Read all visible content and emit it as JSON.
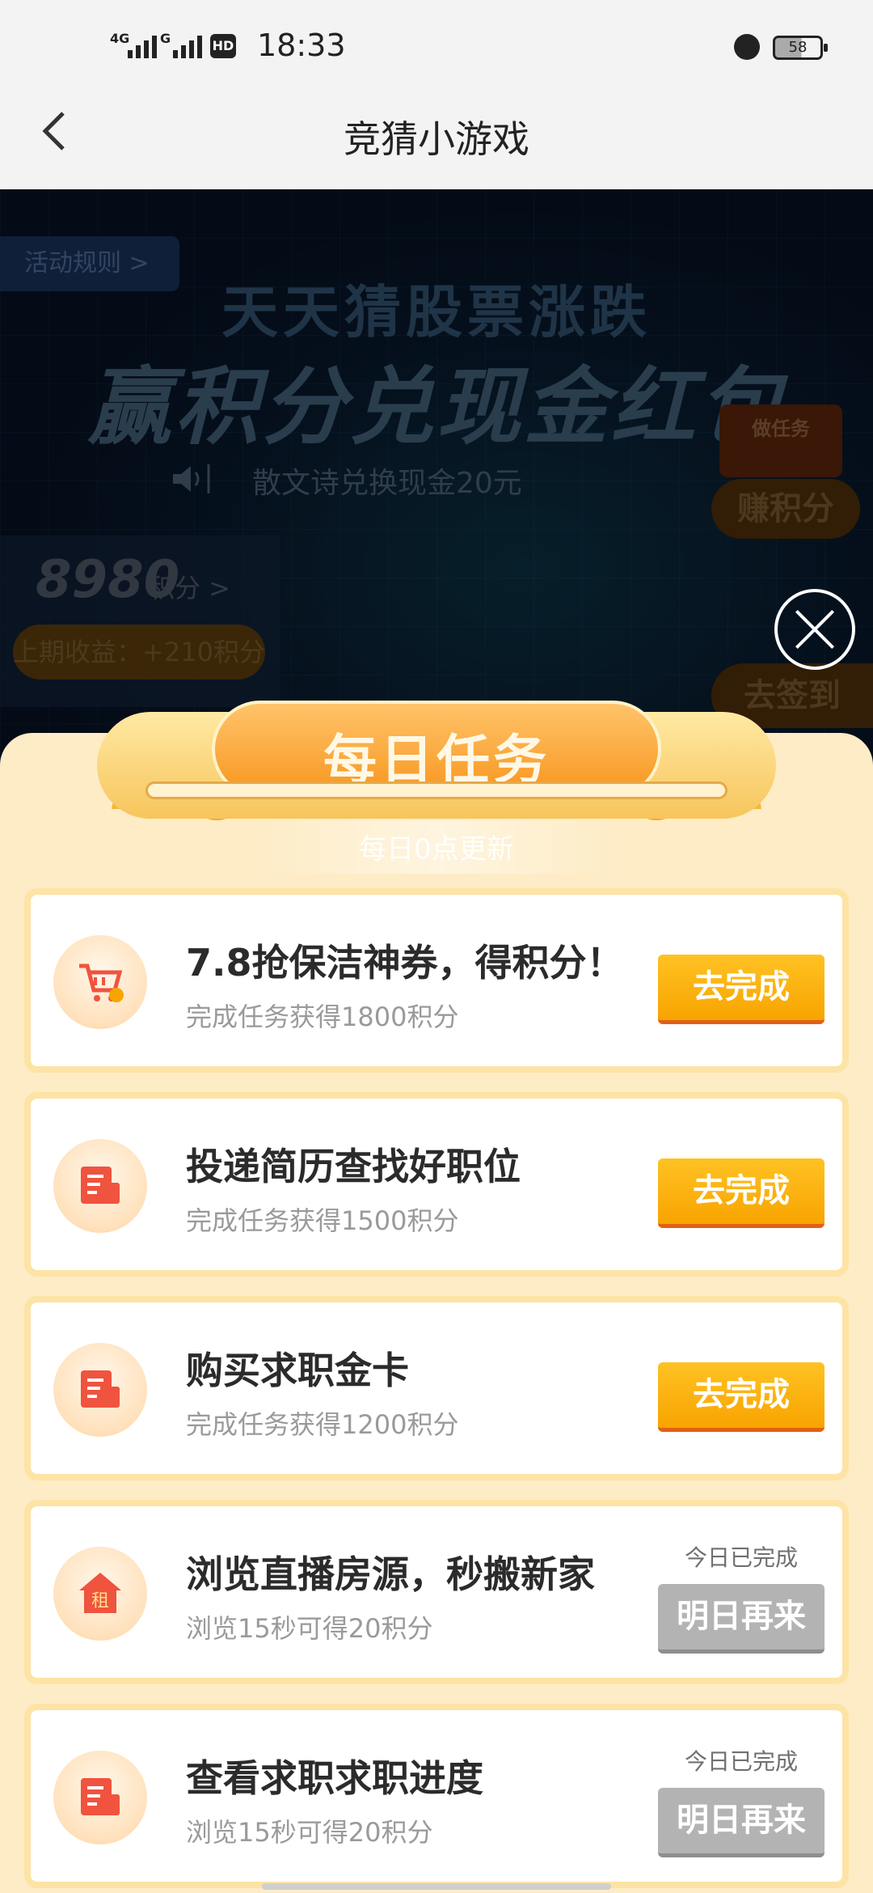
{
  "status_bar": {
    "time": "18:33",
    "network1": "4G",
    "network2": "G",
    "hd_label": "HD",
    "battery": "58"
  },
  "nav": {
    "title": "竞猜小游戏"
  },
  "banner": {
    "rules_label": "活动规则 >",
    "headline1": "天天猜股票涨跌",
    "headline2": "赢积分兑现金红包",
    "announcement": "散文诗兑换现金20元",
    "points_value": "8980",
    "points_label": "积分 >",
    "last_income": "上期收益：+210积分",
    "task_box": "做任务",
    "earn_points": "赚积分",
    "checkin": "去签到"
  },
  "sheet": {
    "title": "每日任务",
    "update_text": "每日0点更新",
    "tasks": [
      {
        "title": "7.8抢保洁神券，得积分！",
        "sub": "完成任务获得1800积分",
        "button": "去完成",
        "icon": "cart-icon"
      },
      {
        "title": "投递简历查找好职位",
        "sub": "完成任务获得1500积分",
        "button": "去完成",
        "icon": "document-icon"
      },
      {
        "title": "购买求职金卡",
        "sub": "完成任务获得1200积分",
        "button": "去完成",
        "icon": "document-icon"
      },
      {
        "title": "浏览直播房源，秒搬新家",
        "sub": "浏览15秒可得20积分",
        "button": "明日再来",
        "done": "今日已完成",
        "icon": "rent-house-icon",
        "icon_text": "租"
      },
      {
        "title": "查看求职求职进度",
        "sub": "浏览15秒可得20积分",
        "button": "明日再来",
        "done": "今日已完成",
        "icon": "document-icon"
      }
    ]
  },
  "colors": {
    "accent_orange": "#f8a400",
    "sheet_bg": "#fdecc6",
    "icon_red": "#f0533e",
    "disabled_gray": "#b3b3b3"
  }
}
